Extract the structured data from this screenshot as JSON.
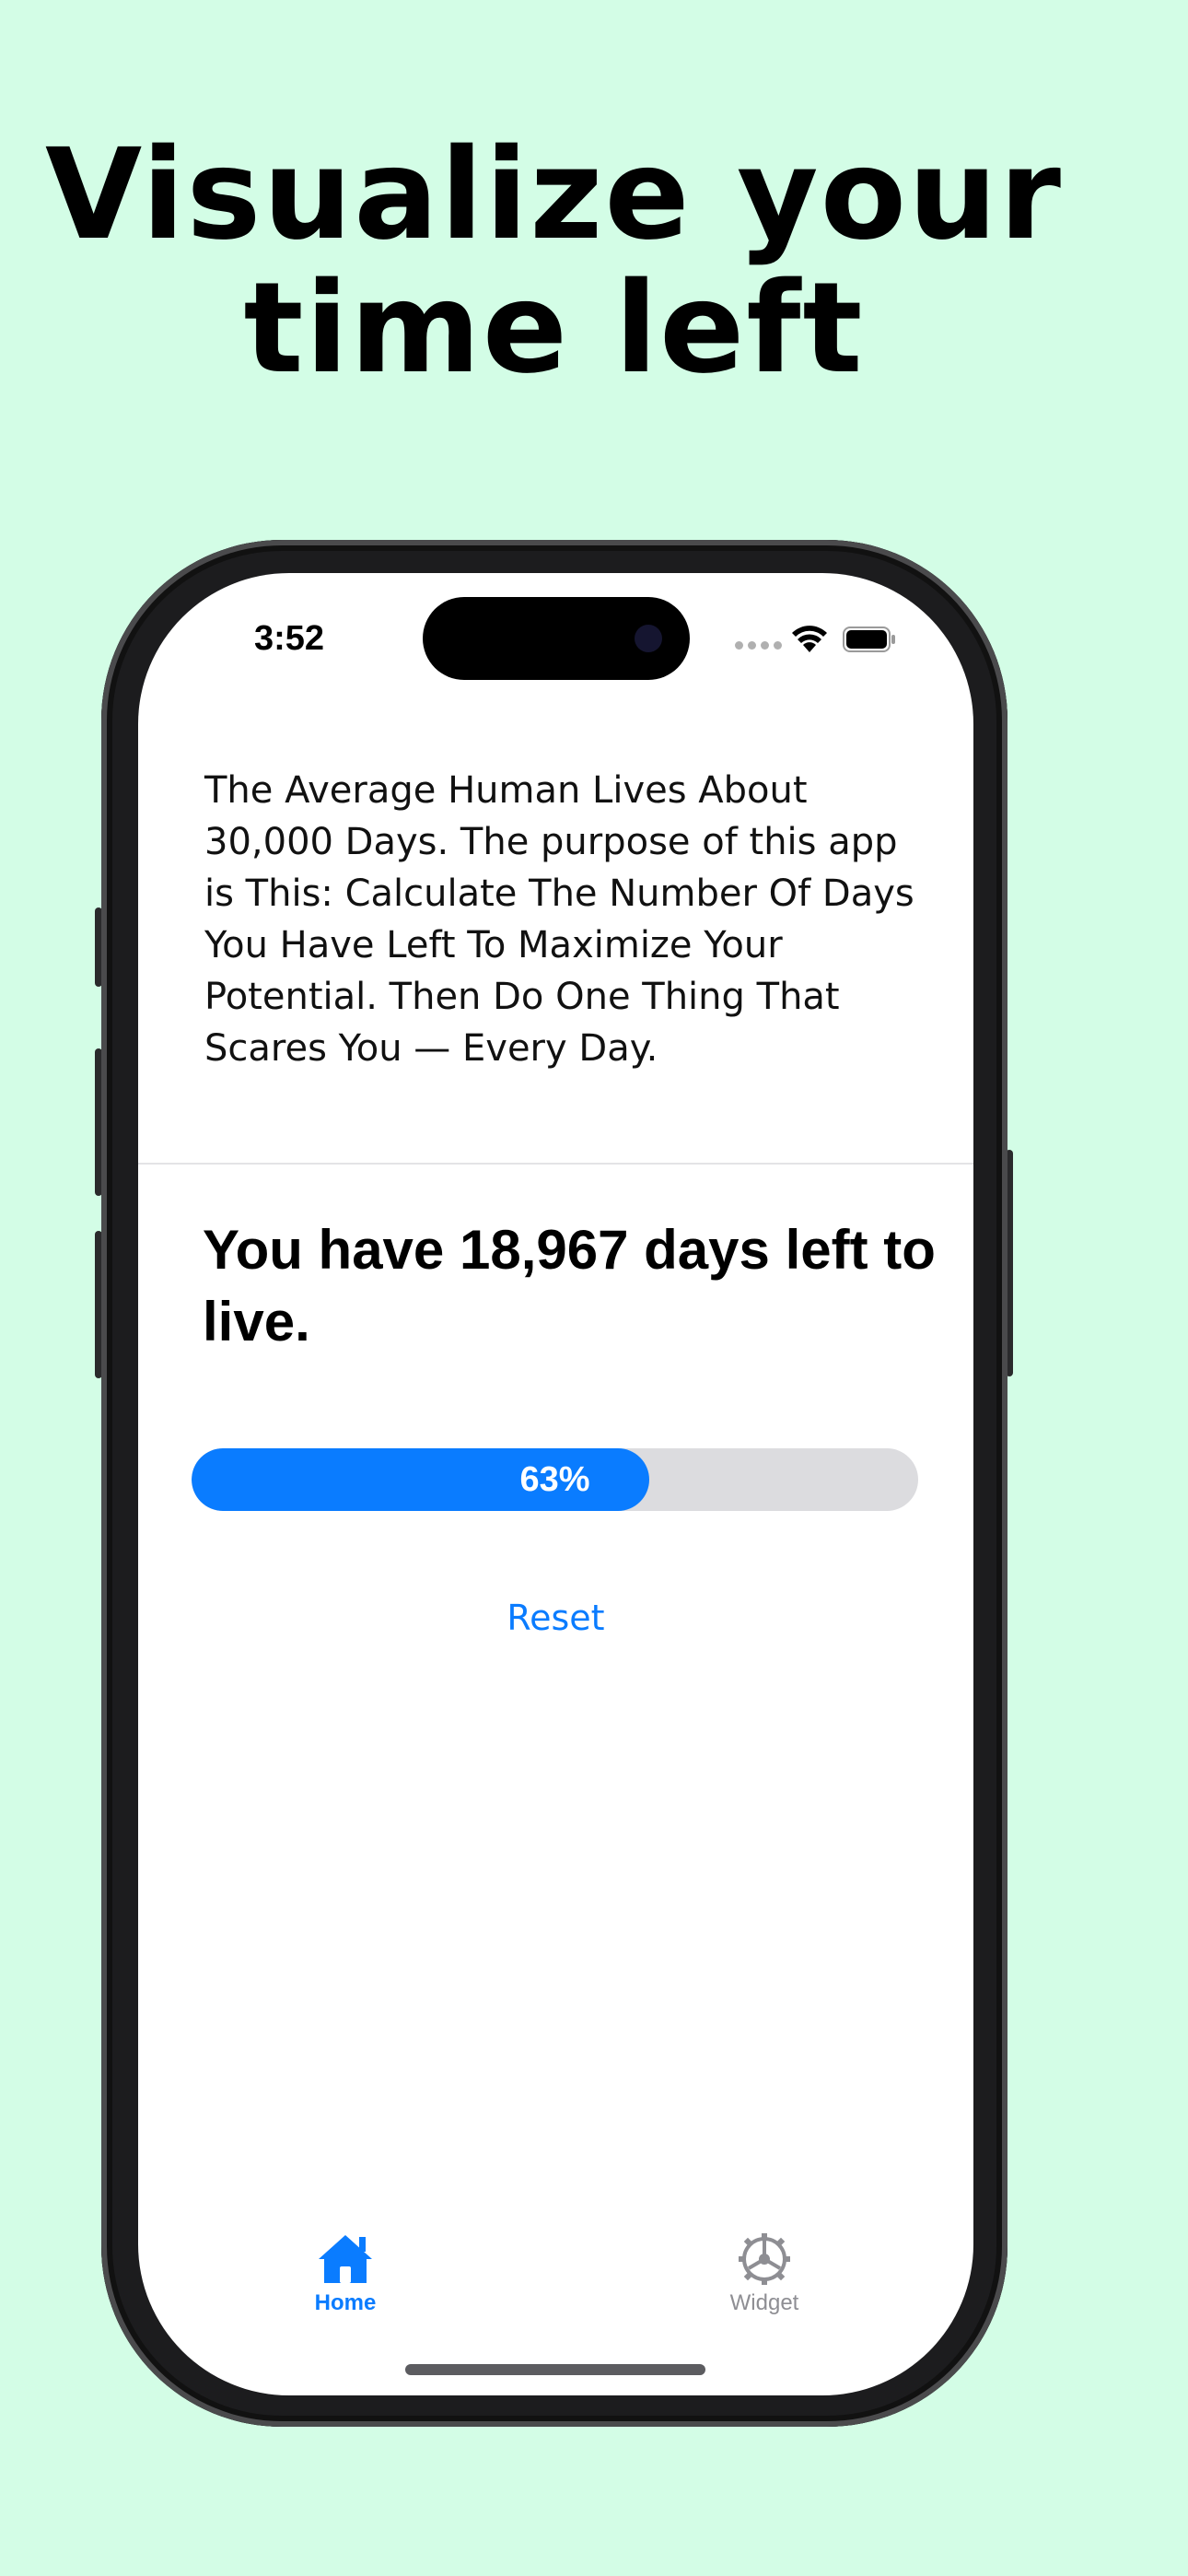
{
  "headline": {
    "line1": "Visualize your",
    "line2": "time left"
  },
  "status_bar": {
    "time": "3:52"
  },
  "main": {
    "intro_text": "The Average Human Lives About 30,000 Days. The purpose of this app is This: Calculate The Number Of Days You Have Left To Maximize Your Potential. Then Do One Thing That Scares You — Every Day.",
    "days_left_text": "You have 18,967 days left to live.",
    "progress": {
      "label": "63%",
      "fraction": 0.63
    },
    "reset_label": "Reset"
  },
  "tab_bar": {
    "tabs": [
      {
        "label": "Home",
        "icon": "house-icon",
        "selected": true
      },
      {
        "label": "Widget",
        "icon": "gear-icon",
        "selected": false
      }
    ]
  },
  "colors": {
    "background": "#d3fde6",
    "accent": "#0a7cff",
    "progress_track": "#dcdcdf",
    "inactive_tab": "#8e8e93"
  }
}
